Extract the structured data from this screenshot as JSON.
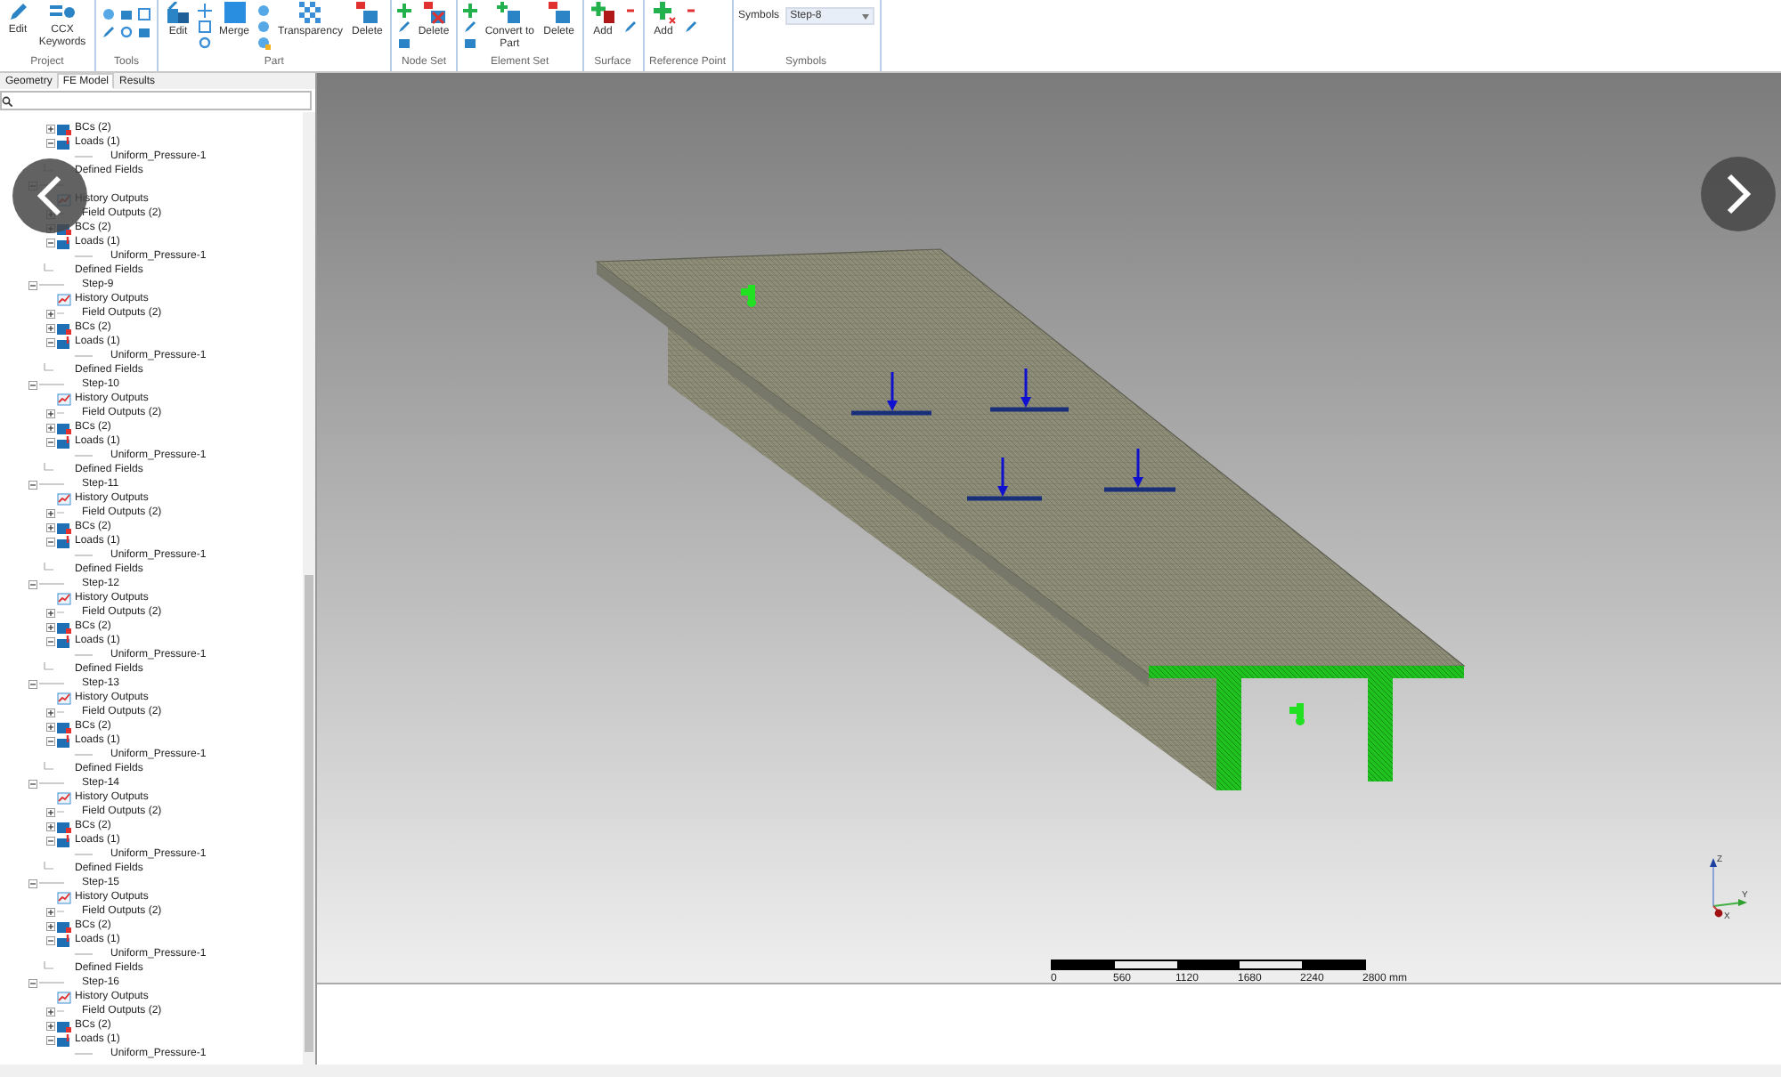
{
  "ribbon": {
    "groups": [
      {
        "label": "Project",
        "items": [
          {
            "kind": "large",
            "label": "Edit"
          },
          {
            "kind": "large",
            "label": "CCX Keywords"
          }
        ]
      },
      {
        "label": "Tools",
        "items": [
          {
            "kind": "grid"
          }
        ]
      },
      {
        "label": "Part",
        "items": [
          {
            "kind": "large",
            "label": "Edit"
          },
          {
            "kind": "stack"
          },
          {
            "kind": "large",
            "label": "Merge"
          },
          {
            "kind": "stack"
          },
          {
            "kind": "large",
            "label": "Transparency"
          },
          {
            "kind": "large",
            "label": "Delete"
          }
        ]
      },
      {
        "label": "Node Set",
        "items": [
          {
            "kind": "stack"
          },
          {
            "kind": "large",
            "label": "Delete"
          }
        ]
      },
      {
        "label": "Element Set",
        "items": [
          {
            "kind": "stack"
          },
          {
            "kind": "large",
            "label": "Convert to Part"
          },
          {
            "kind": "large",
            "label": "Delete"
          }
        ]
      },
      {
        "label": "Surface",
        "items": [
          {
            "kind": "large",
            "label": "Add"
          },
          {
            "kind": "stack"
          }
        ]
      },
      {
        "label": "Reference Point",
        "items": [
          {
            "kind": "large",
            "label": "Add"
          },
          {
            "kind": "stack"
          }
        ]
      },
      {
        "label": "Symbols",
        "items": [
          {
            "kind": "dropdown",
            "label": "Symbols",
            "value": "Step-8"
          }
        ]
      }
    ]
  },
  "panel": {
    "tabs": [
      {
        "label": "Geometry",
        "selected": false
      },
      {
        "label": "FE Model",
        "selected": true
      },
      {
        "label": "Results",
        "selected": false
      }
    ],
    "tree": [
      {
        "children": [
          {
            "kind": "bcs",
            "label": "BCs (2)",
            "expanded": false
          },
          {
            "kind": "loads",
            "label": "Loads (1)",
            "expanded": true,
            "children": [
              {
                "kind": "load",
                "label": "Uniform_Pressure-1"
              }
            ]
          },
          {
            "kind": "fields",
            "label": "Defined Fields"
          }
        ]
      },
      {
        "kind": "step",
        "expanded": true,
        "children": [
          {
            "kind": "history",
            "label": "History Outputs"
          },
          {
            "kind": "outputs",
            "label": "Field Outputs (2)",
            "expanded": false
          },
          {
            "kind": "bcs",
            "label": "BCs (2)",
            "expanded": false
          },
          {
            "kind": "loads",
            "label": "Loads (1)",
            "expanded": true,
            "children": [
              {
                "kind": "load",
                "label": "Uniform_Pressure-1"
              }
            ]
          },
          {
            "kind": "fields",
            "label": "Defined Fields"
          }
        ]
      },
      {
        "kind": "step",
        "label": "Step-9",
        "expanded": true,
        "children": [
          {
            "kind": "history",
            "label": "History Outputs"
          },
          {
            "kind": "outputs",
            "label": "Field Outputs (2)",
            "expanded": false
          },
          {
            "kind": "bcs",
            "label": "BCs (2)",
            "expanded": false
          },
          {
            "kind": "loads",
            "label": "Loads (1)",
            "expanded": true,
            "children": [
              {
                "kind": "load",
                "label": "Uniform_Pressure-1"
              }
            ]
          },
          {
            "kind": "fields",
            "label": "Defined Fields"
          }
        ]
      },
      {
        "kind": "step",
        "label": "Step-10",
        "expanded": true,
        "children": [
          {
            "kind": "history",
            "label": "History Outputs"
          },
          {
            "kind": "outputs",
            "label": "Field Outputs (2)",
            "expanded": false
          },
          {
            "kind": "bcs",
            "label": "BCs (2)",
            "expanded": false
          },
          {
            "kind": "loads",
            "label": "Loads (1)",
            "expanded": true,
            "children": [
              {
                "kind": "load",
                "label": "Uniform_Pressure-1"
              }
            ]
          },
          {
            "kind": "fields",
            "label": "Defined Fields"
          }
        ]
      },
      {
        "kind": "step",
        "label": "Step-11",
        "expanded": true,
        "children": [
          {
            "kind": "history",
            "label": "History Outputs"
          },
          {
            "kind": "outputs",
            "label": "Field Outputs (2)",
            "expanded": false
          },
          {
            "kind": "bcs",
            "label": "BCs (2)",
            "expanded": false
          },
          {
            "kind": "loads",
            "label": "Loads (1)",
            "expanded": true,
            "children": [
              {
                "kind": "load",
                "label": "Uniform_Pressure-1"
              }
            ]
          },
          {
            "kind": "fields",
            "label": "Defined Fields"
          }
        ]
      },
      {
        "kind": "step",
        "label": "Step-12",
        "expanded": true,
        "children": [
          {
            "kind": "history",
            "label": "History Outputs"
          },
          {
            "kind": "outputs",
            "label": "Field Outputs (2)",
            "expanded": false
          },
          {
            "kind": "bcs",
            "label": "BCs (2)",
            "expanded": false
          },
          {
            "kind": "loads",
            "label": "Loads (1)",
            "expanded": true,
            "children": [
              {
                "kind": "load",
                "label": "Uniform_Pressure-1"
              }
            ]
          },
          {
            "kind": "fields",
            "label": "Defined Fields"
          }
        ]
      },
      {
        "kind": "step",
        "label": "Step-13",
        "expanded": true,
        "children": [
          {
            "kind": "history",
            "label": "History Outputs"
          },
          {
            "kind": "outputs",
            "label": "Field Outputs (2)",
            "expanded": false
          },
          {
            "kind": "bcs",
            "label": "BCs (2)",
            "expanded": false
          },
          {
            "kind": "loads",
            "label": "Loads (1)",
            "expanded": true,
            "children": [
              {
                "kind": "load",
                "label": "Uniform_Pressure-1"
              }
            ]
          },
          {
            "kind": "fields",
            "label": "Defined Fields"
          }
        ]
      },
      {
        "kind": "step",
        "label": "Step-14",
        "expanded": true,
        "children": [
          {
            "kind": "history",
            "label": "History Outputs"
          },
          {
            "kind": "outputs",
            "label": "Field Outputs (2)",
            "expanded": false
          },
          {
            "kind": "bcs",
            "label": "BCs (2)",
            "expanded": false
          },
          {
            "kind": "loads",
            "label": "Loads (1)",
            "expanded": true,
            "children": [
              {
                "kind": "load",
                "label": "Uniform_Pressure-1"
              }
            ]
          },
          {
            "kind": "fields",
            "label": "Defined Fields"
          }
        ]
      },
      {
        "kind": "step",
        "label": "Step-15",
        "expanded": true,
        "children": [
          {
            "kind": "history",
            "label": "History Outputs"
          },
          {
            "kind": "outputs",
            "label": "Field Outputs (2)",
            "expanded": false
          },
          {
            "kind": "bcs",
            "label": "BCs (2)",
            "expanded": false
          },
          {
            "kind": "loads",
            "label": "Loads (1)",
            "expanded": true,
            "children": [
              {
                "kind": "load",
                "label": "Uniform_Pressure-1"
              }
            ]
          },
          {
            "kind": "fields",
            "label": "Defined Fields"
          }
        ]
      },
      {
        "kind": "step",
        "label": "Step-16",
        "expanded": true,
        "children": [
          {
            "kind": "history",
            "label": "History Outputs"
          },
          {
            "kind": "outputs",
            "label": "Field Outputs (2)",
            "expanded": false
          },
          {
            "kind": "bcs",
            "label": "BCs (2)",
            "expanded": false
          },
          {
            "kind": "loads",
            "label": "Loads (1)",
            "expanded": true,
            "children": [
              {
                "kind": "load",
                "label": "Uniform_Pressure-1"
              }
            ]
          }
        ]
      }
    ]
  },
  "viewport": {
    "scale_bar": {
      "ticks": [
        "0",
        "560",
        "1120",
        "1680",
        "2240",
        "2800 mm"
      ]
    },
    "axes": {
      "z": "Z",
      "y": "Y",
      "x": "X"
    }
  }
}
